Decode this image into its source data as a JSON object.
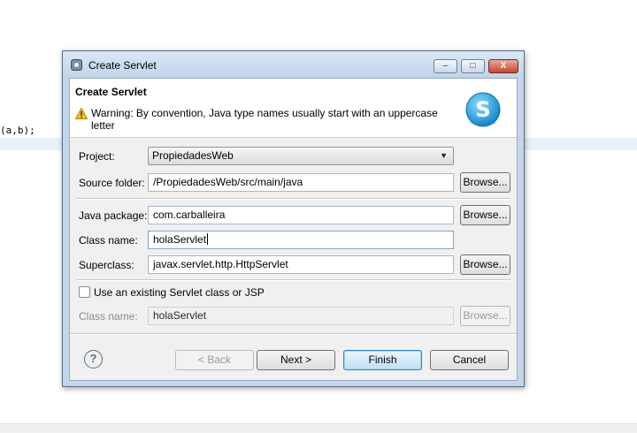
{
  "editor": {
    "code_fragment": "(a,b);"
  },
  "dialog": {
    "title": "Create Servlet",
    "heading": "Create Servlet",
    "warning": "Warning: By convention, Java type names usually start with an uppercase letter",
    "window_buttons": {
      "minimize": "–",
      "maximize": "□",
      "close": "X"
    }
  },
  "form": {
    "project_label": "Project:",
    "project_value": "PropiedadesWeb",
    "source_folder_label": "Source folder:",
    "source_folder_value": "/PropiedadesWeb/src/main/java",
    "java_package_label": "Java package:",
    "java_package_value": "com.carballeira",
    "class_name_label": "Class name:",
    "class_name_value": "holaServlet",
    "superclass_label": "Superclass:",
    "superclass_value": "javax.servlet.http.HttpServlet",
    "use_existing_label": "Use an existing Servlet class or JSP",
    "use_existing_checked": false,
    "existing_class_label": "Class name:",
    "existing_class_value": "holaServlet",
    "browse_label": "Browse..."
  },
  "buttons": {
    "back": "< Back",
    "next": "Next >",
    "finish": "Finish",
    "cancel": "Cancel",
    "help": "?"
  },
  "colors": {
    "window_frame": "#c3d6ec",
    "dialog_bg": "#f0f0f0",
    "default_button": "#bfe0f5",
    "logo": "#1aa0dc"
  }
}
